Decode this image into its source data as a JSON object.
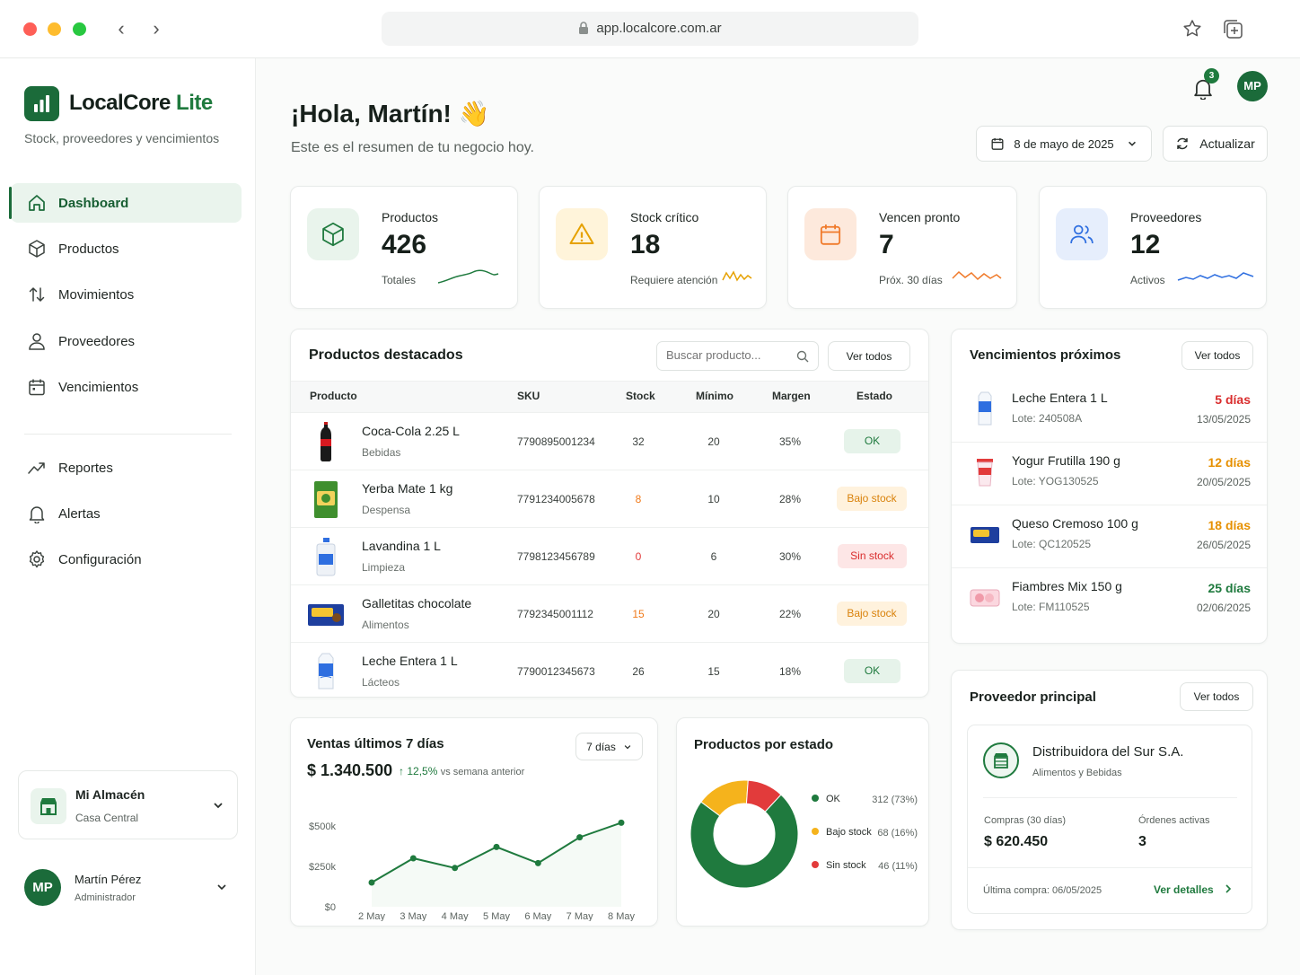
{
  "browser": {
    "url": "app.localcore.com.ar"
  },
  "app": {
    "brand_main": "LocalCore",
    "brand_suffix": "Lite",
    "tagline": "Stock, proveedores y vencimientos"
  },
  "nav": {
    "items": [
      {
        "label": "Dashboard",
        "icon": "home-icon",
        "active": true
      },
      {
        "label": "Productos",
        "icon": "box-icon"
      },
      {
        "label": "Movimientos",
        "icon": "arrows-updown-icon"
      },
      {
        "label": "Proveedores",
        "icon": "user-icon"
      },
      {
        "label": "Vencimientos",
        "icon": "calendar-icon"
      }
    ],
    "secondary": [
      {
        "label": "Reportes",
        "icon": "trend-icon"
      },
      {
        "label": "Alertas",
        "icon": "bell-icon"
      },
      {
        "label": "Configuración",
        "icon": "gear-icon"
      }
    ]
  },
  "store": {
    "name": "Mi Almacén",
    "branch": "Casa Central"
  },
  "user": {
    "initials": "MP",
    "name": "Martín Pérez",
    "role": "Administrador"
  },
  "header": {
    "greeting": "¡Hola, Martín! 👋",
    "subtitle": "Este es el resumen de tu negocio hoy.",
    "date": "8 de mayo de 2025",
    "refresh": "Actualizar",
    "notifications": "3",
    "avatar": "MP"
  },
  "kpis": [
    {
      "label": "Productos",
      "value": "426",
      "note": "Totales",
      "color": "#1f7a3e",
      "bg": "#e9f4ec",
      "icon": "box-icon"
    },
    {
      "label": "Stock crítico",
      "value": "18",
      "note": "Requiere atención",
      "color": "#e6a100",
      "bg": "#fff4da",
      "icon": "warning-icon"
    },
    {
      "label": "Vencen pronto",
      "value": "7",
      "note": "Próx. 30 días",
      "color": "#f07a2a",
      "bg": "#fde9dc",
      "icon": "calendar-icon"
    },
    {
      "label": "Proveedores",
      "value": "12",
      "note": "Activos",
      "color": "#2f6fe0",
      "bg": "#e6eefc",
      "icon": "users-icon"
    }
  ],
  "featured": {
    "title": "Productos destacados",
    "search_placeholder": "Buscar producto...",
    "view_all": "Ver todos",
    "columns": [
      "Producto",
      "SKU",
      "Stock",
      "Mínimo",
      "Margen",
      "Estado"
    ],
    "rows": [
      {
        "name": "Coca-Cola 2.25 L",
        "cat": "Bebidas",
        "sku": "7790895001234",
        "stock": "32",
        "min": "20",
        "margin": "35%",
        "status": "OK",
        "kind": "ok"
      },
      {
        "name": "Yerba Mate 1 kg",
        "cat": "Despensa",
        "sku": "7791234005678",
        "stock": "8",
        "min": "10",
        "margin": "28%",
        "status": "Bajo stock",
        "kind": "low"
      },
      {
        "name": "Lavandina 1 L",
        "cat": "Limpieza",
        "sku": "7798123456789",
        "stock": "0",
        "min": "6",
        "margin": "30%",
        "status": "Sin stock",
        "kind": "out"
      },
      {
        "name": "Galletitas chocolate",
        "cat": "Alimentos",
        "sku": "7792345001112",
        "stock": "15",
        "min": "20",
        "margin": "22%",
        "status": "Bajo stock",
        "kind": "low"
      },
      {
        "name": "Leche Entera 1 L",
        "cat": "Lácteos",
        "sku": "7790012345673",
        "stock": "26",
        "min": "15",
        "margin": "18%",
        "status": "OK",
        "kind": "ok"
      }
    ]
  },
  "expiring": {
    "title": "Vencimientos próximos",
    "view_all": "Ver todos",
    "items": [
      {
        "name": "Leche Entera 1 L",
        "lote": "Lote: 240508A",
        "days": "5 días",
        "date": "13/05/2025",
        "color": "#d92d2d"
      },
      {
        "name": "Yogur Frutilla 190 g",
        "lote": "Lote: YOG130525",
        "days": "12 días",
        "date": "20/05/2025",
        "color": "#e69000"
      },
      {
        "name": "Queso Cremoso 100 g",
        "lote": "Lote: QC120525",
        "days": "18 días",
        "date": "26/05/2025",
        "color": "#e69000"
      },
      {
        "name": "Fiambres Mix 150 g",
        "lote": "Lote: FM110525",
        "days": "25 días",
        "date": "02/06/2025",
        "color": "#1f7a3e"
      }
    ]
  },
  "sales": {
    "title": "Ventas últimos 7 días",
    "total": "$ 1.340.500",
    "change": "12,5%",
    "change_note": "vs semana anterior",
    "range": "7 días"
  },
  "status_chart": {
    "title": "Productos por estado"
  },
  "supplier": {
    "title": "Proveedor principal",
    "view_all": "Ver todos",
    "name": "Distribuidora del Sur S.A.",
    "category": "Alimentos y Bebidas",
    "purchases_label": "Compras (30 días)",
    "purchases": "$ 620.450",
    "orders_label": "Órdenes activas",
    "orders": "3",
    "last_purchase": "Última compra: 06/05/2025",
    "details": "Ver detalles"
  },
  "chart_data": [
    {
      "type": "line",
      "categories": [
        "2 May",
        "3 May",
        "4 May",
        "5 May",
        "6 May",
        "7 May",
        "8 May"
      ],
      "series": [
        {
          "values": [
            150000,
            300000,
            240000,
            370000,
            270000,
            430000,
            520000
          ]
        }
      ],
      "ylabel": "",
      "y_ticks": [
        "$0",
        "$250k",
        "$500k"
      ],
      "ylim": [
        0,
        500000
      ],
      "color": "#1f7a3e",
      "grid": false
    },
    {
      "type": "pie",
      "donut": true,
      "categories": [
        "OK",
        "Bajo stock",
        "Sin stock"
      ],
      "values": [
        312,
        68,
        46
      ],
      "value_labels": [
        "312 (73%)",
        "68 (16%)",
        "46 (11%)"
      ],
      "colors": [
        "#1f7a3e",
        "#f5b31c",
        "#e23b3b"
      ],
      "legend": "right"
    }
  ]
}
